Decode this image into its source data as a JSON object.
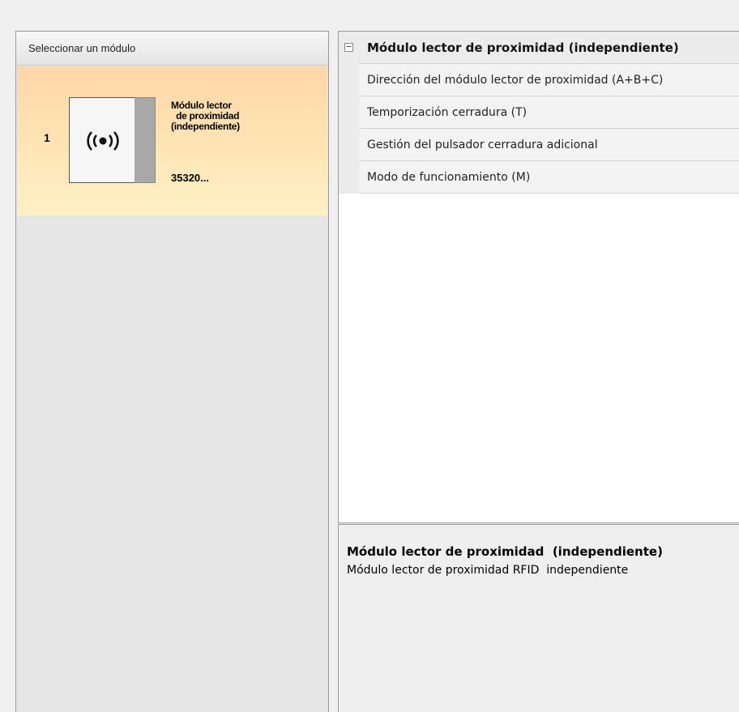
{
  "left_panel": {
    "header": "Seleccionar un módulo",
    "modules": [
      {
        "index": "1",
        "name": "Módulo lector\n  de proximidad\n(independiente)",
        "code": "35320...",
        "icon": "rfid-wireless-icon"
      }
    ]
  },
  "properties": {
    "category": {
      "label": "Módulo lector de proximidad  (independiente)",
      "expander": "−"
    },
    "rows": [
      {
        "label": "Dirección del módulo lector de proximidad  (A+B+C)"
      },
      {
        "label": "Temporización cerradura (T)"
      },
      {
        "label": "Gestión del pulsador cerradura adicional"
      },
      {
        "label": "Modo de funcionamiento (M)"
      }
    ]
  },
  "description": {
    "title": "Módulo lector de proximidad  (independiente)",
    "text": "Módulo lector de proximidad RFID  independiente"
  },
  "colors": {
    "selected_card_top": "#ffd6a8",
    "selected_card_bottom": "#fff0c6",
    "panel_bg": "#e6e6e6",
    "grid_bg": "#ffffff"
  }
}
